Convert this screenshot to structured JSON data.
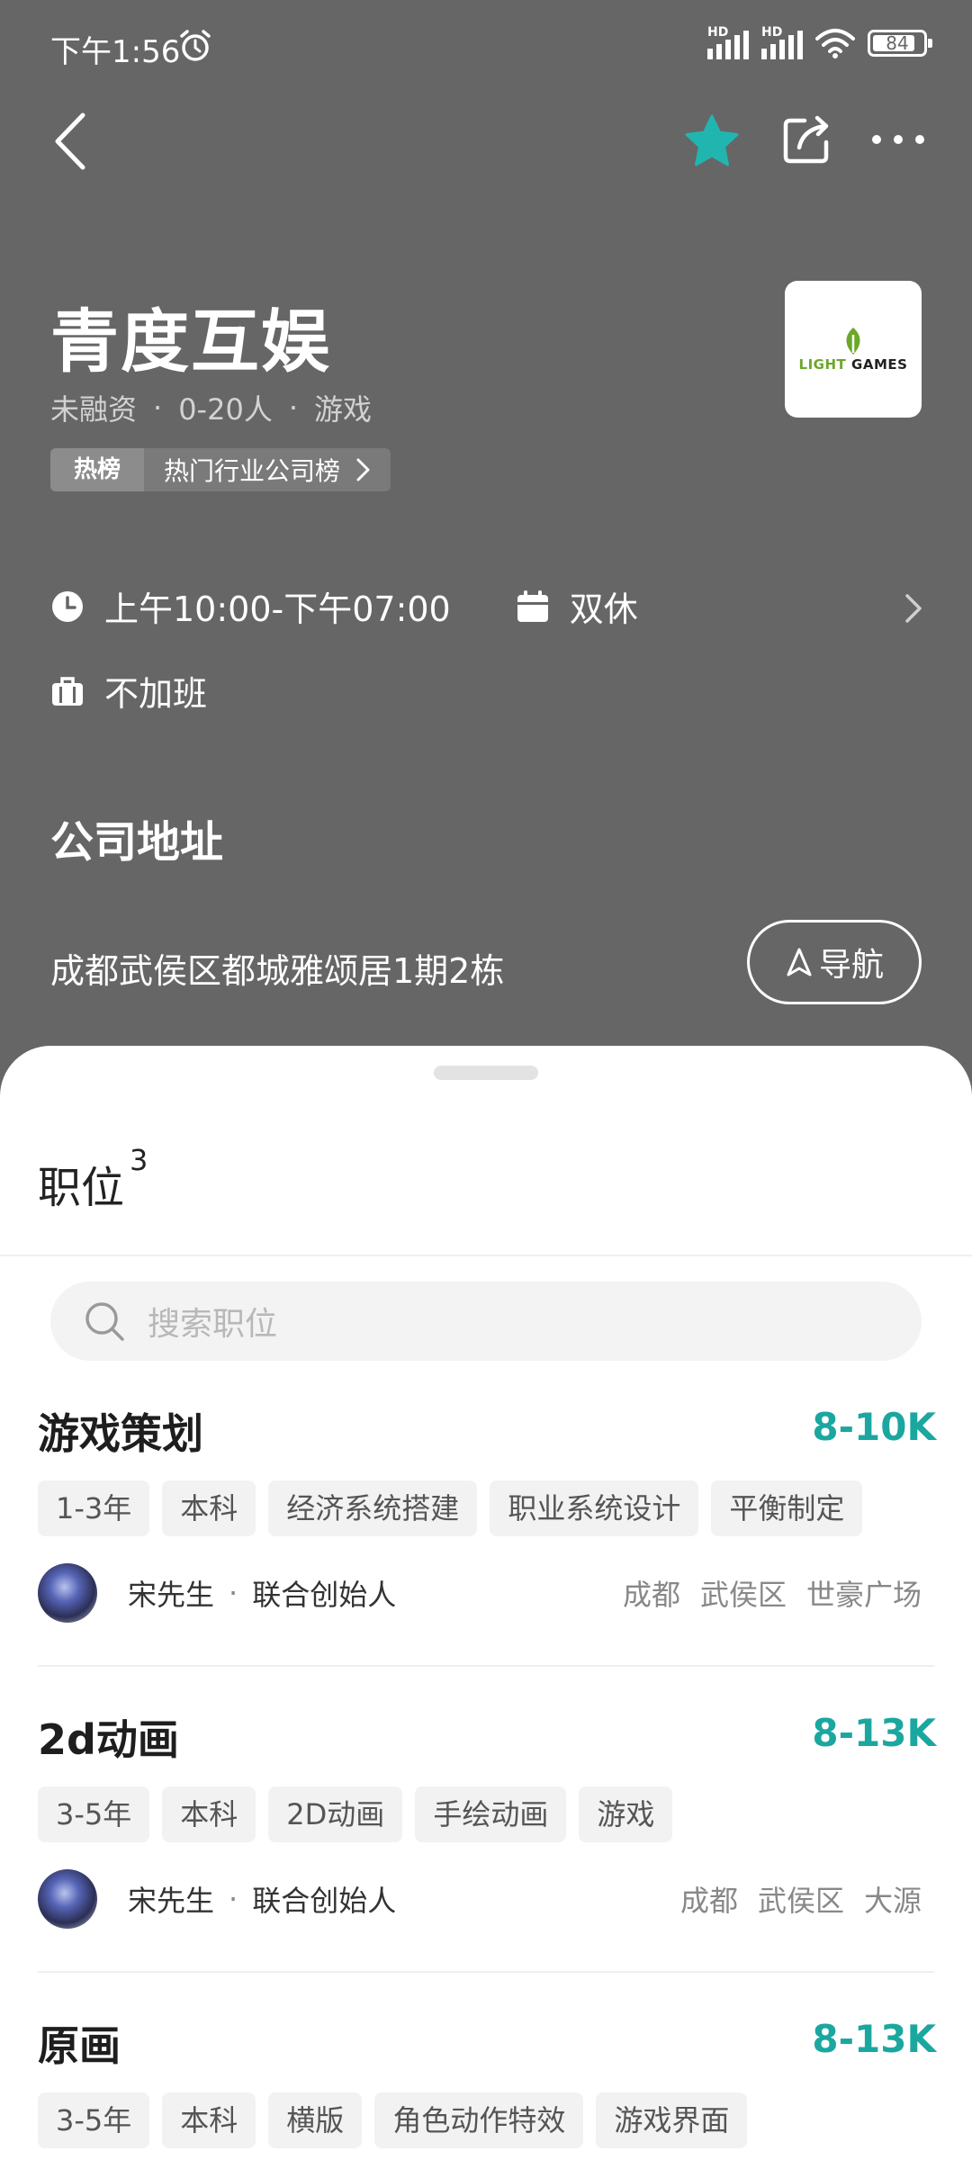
{
  "status_bar": {
    "time": "下午1:56",
    "battery": "84"
  },
  "company": {
    "name": "青度互娱",
    "funding": "未融资",
    "size": "0-20人",
    "industry": "游戏",
    "separator": "·",
    "hot_badge": "热榜",
    "hot_label": "热门行业公司榜",
    "logo_text_1": "LIGHT",
    "logo_text_2": "GAMES"
  },
  "work_info": {
    "hours": "上午10:00-下午07:00",
    "rest": "双休",
    "overtime": "不加班"
  },
  "address": {
    "title": "公司地址",
    "text": "成都武侯区都城雅颂居1期2栋",
    "nav_label": "导航"
  },
  "positions": {
    "title": "职位",
    "count": "3",
    "search_placeholder": "搜索职位",
    "jobs": [
      {
        "title": "游戏策划",
        "salary": "8-10K",
        "tags": [
          "1-3年",
          "本科",
          "经济系统搭建",
          "职业系统设计",
          "平衡制定"
        ],
        "contact_name": "宋先生",
        "contact_role": "联合创始人",
        "location": [
          "成都",
          "武侯区",
          "世豪广场"
        ]
      },
      {
        "title": "2d动画",
        "salary": "8-13K",
        "tags": [
          "3-5年",
          "本科",
          "2D动画",
          "手绘动画",
          "游戏"
        ],
        "contact_name": "宋先生",
        "contact_role": "联合创始人",
        "location": [
          "成都",
          "武侯区",
          "大源"
        ]
      },
      {
        "title": "原画",
        "salary": "8-13K",
        "tags": [
          "3-5年",
          "本科",
          "横版",
          "角色动作特效",
          "游戏界面"
        ]
      }
    ]
  },
  "colors": {
    "background": "#666666",
    "accent": "#1ba7a0",
    "star": "#21b5b0"
  }
}
